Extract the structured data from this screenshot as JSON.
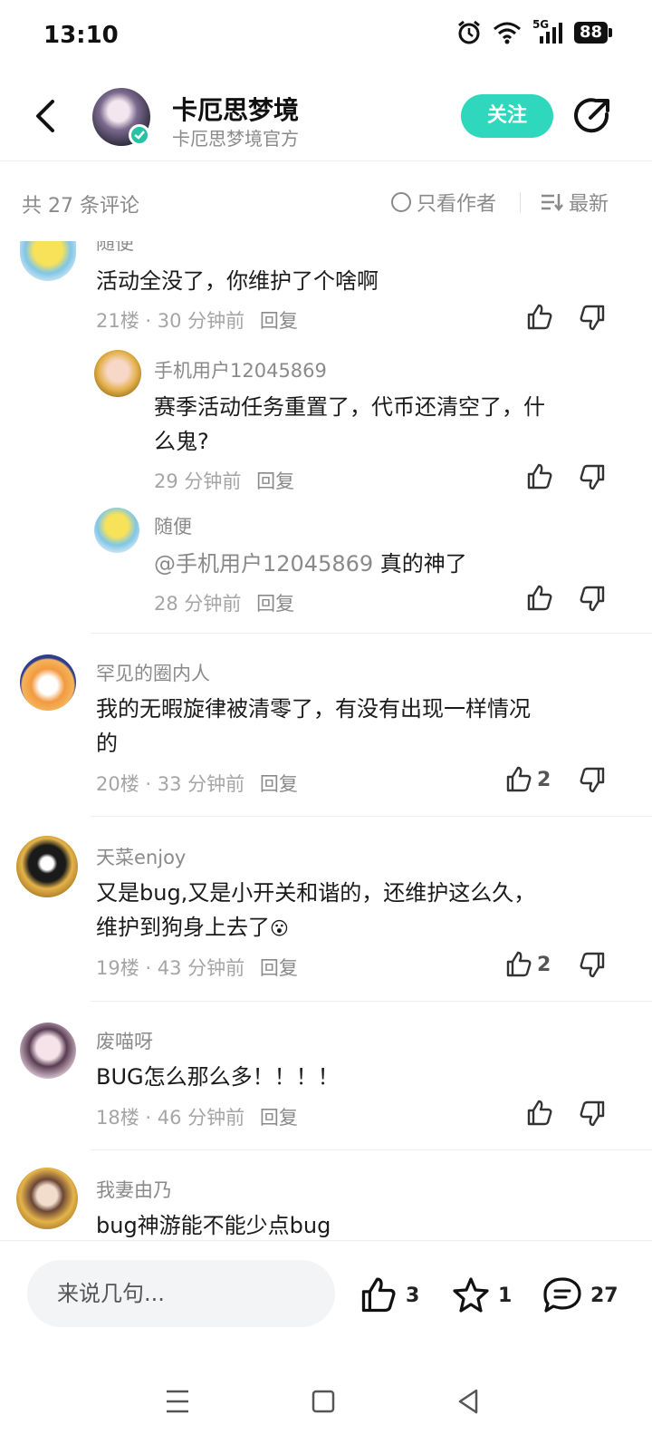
{
  "status_bar": {
    "time": "13:10",
    "network": "5G",
    "battery": "88",
    "icons": [
      "alarm-icon",
      "wifi-icon",
      "signal-icon",
      "battery-icon"
    ]
  },
  "header": {
    "author_name": "卡厄思梦境",
    "author_subtitle": "卡厄思梦境官方",
    "follow_label": "关注",
    "accent_color": "#2fd8bd"
  },
  "filter_bar": {
    "comment_count": "共 27 条评论",
    "author_only": "只看作者",
    "sort": "最新"
  },
  "comments": [
    {
      "user": "随便",
      "text": "活动全没了，你维护了个啥啊",
      "floor": "21楼",
      "time": "30 分钟前",
      "reply_label": "回复",
      "likes": "",
      "replies": [
        {
          "user": "手机用户12045869",
          "text_line1": "赛季活动任务重置了，代币还清空了，什",
          "text_line2": "么鬼?",
          "time": "29 分钟前",
          "reply_label": "回复"
        },
        {
          "user": "随便",
          "mention": "@手机用户12045869",
          "text": "真的神了",
          "time": "28 分钟前",
          "reply_label": "回复"
        }
      ]
    },
    {
      "user": "罕见的圈内人",
      "text_line1": "我的无暇旋律被清零了，有没有出现一样情况",
      "text_line2": "的",
      "floor": "20楼",
      "time": "33 分钟前",
      "reply_label": "回复",
      "likes": "2"
    },
    {
      "user": "天菜enjoy",
      "text_line1": "又是bug,又是小开关和谐的，还维护这么久，",
      "text_line2": "维护到狗身上去了",
      "emoji": "😮",
      "floor": "19楼",
      "time": "43 分钟前",
      "reply_label": "回复",
      "likes": "2"
    },
    {
      "user": "废喵呀",
      "text": "BUG怎么那么多！！！！",
      "floor": "18楼",
      "time": "46 分钟前",
      "reply_label": "回复",
      "likes": ""
    },
    {
      "user": "我妻由乃",
      "text": "bug神游能不能少点bug"
    }
  ],
  "bottom_bar": {
    "input_placeholder": "来说几句...",
    "like_count": "3",
    "favorite_count": "1",
    "comment_count": "27"
  }
}
